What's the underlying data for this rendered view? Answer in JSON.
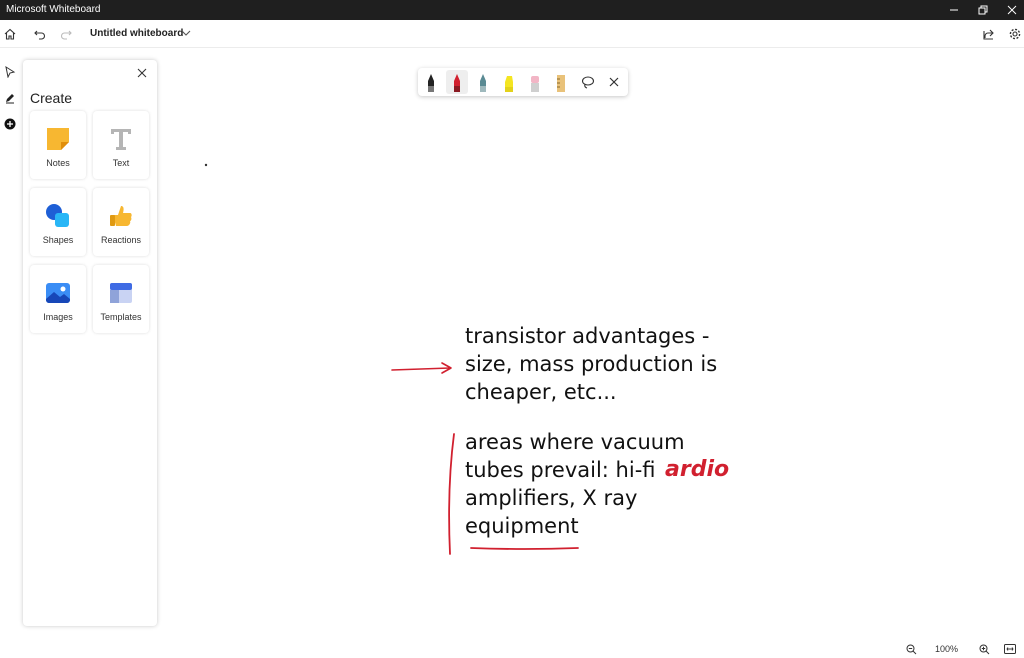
{
  "window": {
    "title": "Microsoft Whiteboard"
  },
  "appbar": {
    "board_title": "Untitled whiteboard"
  },
  "create_panel": {
    "heading": "Create",
    "tiles": [
      {
        "label": "Notes",
        "icon": "sticky-note-icon"
      },
      {
        "label": "Text",
        "icon": "text-icon"
      },
      {
        "label": "Shapes",
        "icon": "shapes-icon"
      },
      {
        "label": "Reactions",
        "icon": "thumbs-up-icon"
      },
      {
        "label": "Images",
        "icon": "image-icon"
      },
      {
        "label": "Templates",
        "icon": "templates-icon"
      }
    ]
  },
  "ink_toolbar": {
    "tools": [
      "black-pen-icon",
      "red-pen-icon",
      "teal-pen-icon",
      "yellow-highlighter-icon",
      "eraser-icon",
      "ruler-icon",
      "lasso-icon",
      "close-icon"
    ],
    "selected": "red-pen-icon"
  },
  "canvas": {
    "block1": [
      "transistor advantages -",
      "size, mass production is",
      "cheaper, etc..."
    ],
    "block2": [
      "areas where vacuum",
      "tubes prevail: hi-fi",
      "amplifiers, X ray",
      "equipment"
    ],
    "annotation": "ardio",
    "ink_color": "#111111",
    "accent_ink": "#d1202f"
  },
  "zoom": {
    "level": "100%"
  }
}
